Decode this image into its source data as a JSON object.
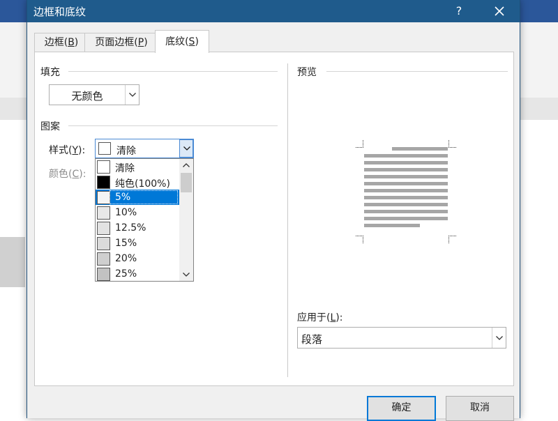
{
  "dialog": {
    "title": "边框和底纹",
    "help_label": "?",
    "close_icon": "close-icon"
  },
  "tabs": [
    {
      "label": "边框",
      "key": "B"
    },
    {
      "label": "页面边框",
      "key": "P"
    },
    {
      "label": "底纹",
      "key": "S",
      "active": true
    }
  ],
  "fill": {
    "section_label": "填充",
    "value": "无颜色"
  },
  "pattern": {
    "section_label": "图案",
    "style_label": "样式",
    "style_key": "Y",
    "style_value": "清除",
    "color_label": "颜色",
    "color_key": "C",
    "options": [
      {
        "label": "清除",
        "swatch": "#ffffff"
      },
      {
        "label": "纯色(100%)",
        "swatch": "#000000"
      },
      {
        "label": "5%",
        "swatch": "#f4f4f4",
        "selected": true
      },
      {
        "label": "10%",
        "swatch": "#e8e8e8"
      },
      {
        "label": "12.5%",
        "swatch": "#e2e2e2"
      },
      {
        "label": "15%",
        "swatch": "#dbdbdb"
      },
      {
        "label": "20%",
        "swatch": "#cfcfcf"
      },
      {
        "label": "25%",
        "swatch": "#c2c2c2"
      }
    ]
  },
  "preview": {
    "section_label": "预览",
    "apply_label": "应用于",
    "apply_key": "L",
    "apply_value": "段落"
  },
  "buttons": {
    "ok": "确定",
    "cancel": "取消"
  },
  "colors": {
    "titlebar": "#1f5b8c",
    "selection": "#0078d7",
    "preview_lines": "#a6a6a6"
  }
}
